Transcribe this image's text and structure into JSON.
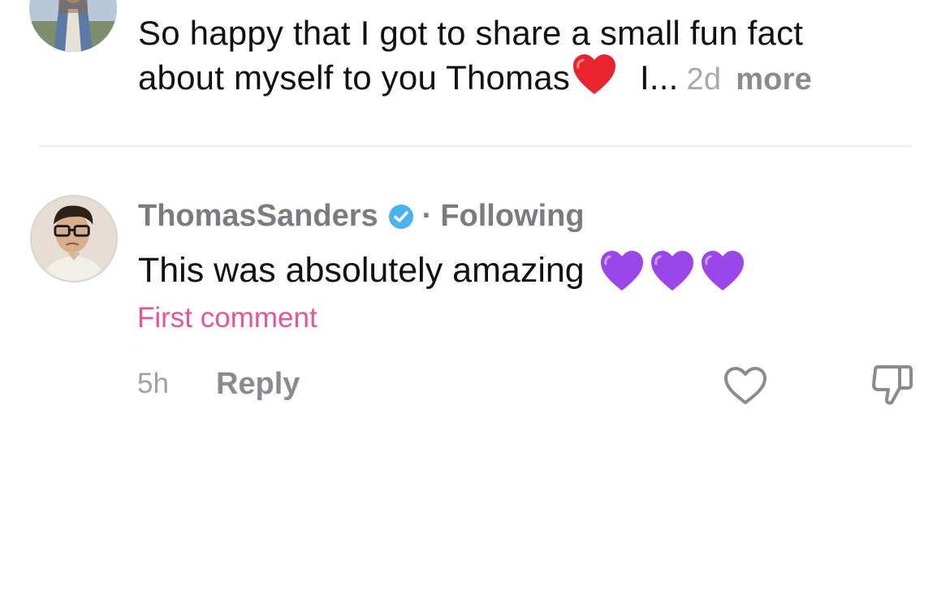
{
  "comments": [
    {
      "avatar_icon": "user-avatar",
      "text_line1": "So happy that I got to share a small fun fact",
      "text_line2": "about myself to you Thomas",
      "emoji": "red-heart-emoji",
      "truncated": "I...",
      "age": "2d",
      "more_label": "more"
    },
    {
      "avatar_icon": "thomas-avatar",
      "author": "ThomasSanders",
      "verified_icon": "verified-badge-icon",
      "separator": "·",
      "relation": "Following",
      "text": "This was absolutely amazing",
      "emojis": [
        "purple-heart-emoji",
        "purple-heart-emoji",
        "purple-heart-emoji"
      ],
      "badge": "First comment",
      "age": "5h",
      "reply_label": "Reply",
      "like_icon": "heart-outline-icon",
      "dislike_icon": "thumbs-down-icon"
    }
  ],
  "colors": {
    "text": "#111111",
    "muted": "#8a8a8f",
    "badge": "#e8549a",
    "verified": "#4ab3ee",
    "purple_heart": "#9b46e8",
    "red_heart": "#e8252c"
  }
}
